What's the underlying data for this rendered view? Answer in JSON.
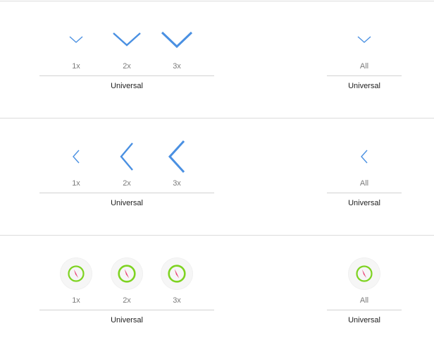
{
  "sets": [
    {
      "name": "chevron-down",
      "scales": [
        "1x",
        "2x",
        "3x"
      ],
      "universal_label": "Universal",
      "single_label": "All",
      "single_universal_label": "Universal"
    },
    {
      "name": "chevron-left",
      "scales": [
        "1x",
        "2x",
        "3x"
      ],
      "universal_label": "Universal",
      "single_label": "All",
      "single_universal_label": "Universal"
    },
    {
      "name": "compass",
      "scales": [
        "1x",
        "2x",
        "3x"
      ],
      "universal_label": "Universal",
      "single_label": "All",
      "single_universal_label": "Universal"
    }
  ],
  "colors": {
    "chevron": "#4a90e2",
    "compass_ring": "#7ed321",
    "compass_needle": "#ff5f8f"
  }
}
